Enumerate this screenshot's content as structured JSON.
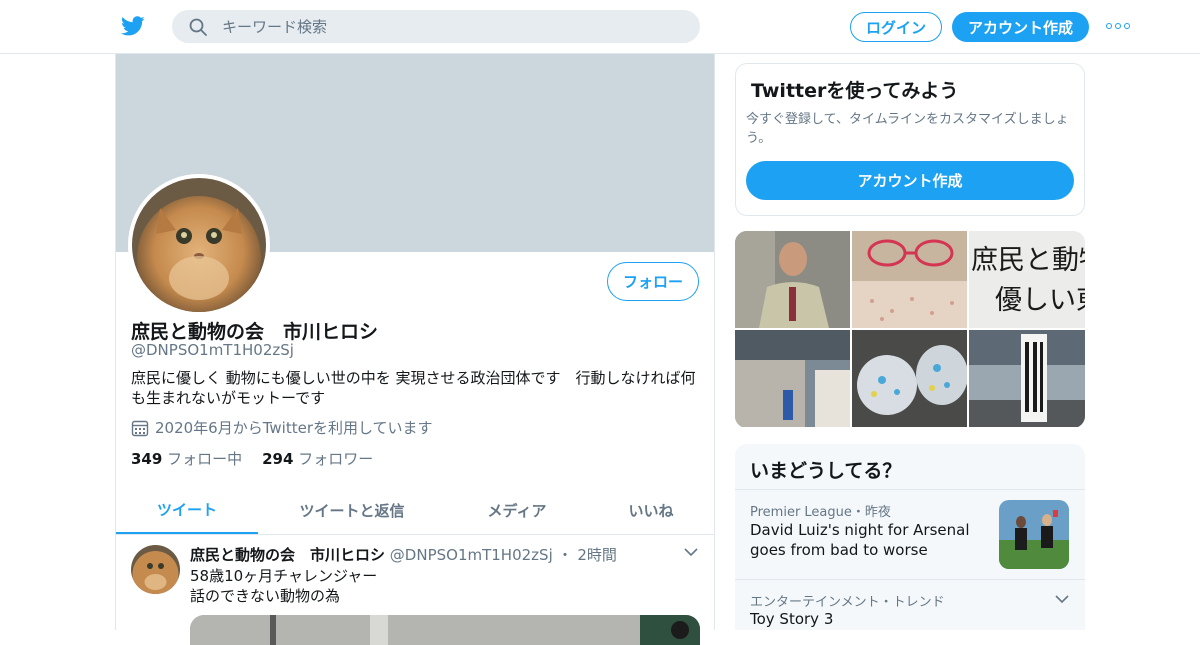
{
  "header": {
    "search_placeholder": "キーワード検索",
    "login_label": "ログイン",
    "signup_label": "アカウント作成",
    "icons": [
      "twitter-bird-icon",
      "search-icon",
      "more-dots-icon"
    ]
  },
  "profile": {
    "display_name": "庶民と動物の会　市川ヒロシ",
    "handle": "@DNPSO1mT1H02zSj",
    "follow_label": "フォロー",
    "bio": "庶民に優しく 動物にも優しい世の中を 実現させる政治団体です　行動しなければ何も生まれないがモットーです",
    "joined": "2020年6月からTwitterを利用しています",
    "following_count": "349",
    "following_label": "フォロー中",
    "followers_count": "294",
    "followers_label": "フォロワー"
  },
  "tabs": [
    {
      "label": "ツイート",
      "active": true
    },
    {
      "label": "ツイートと返信",
      "active": false
    },
    {
      "label": "メディア",
      "active": false
    },
    {
      "label": "いいね",
      "active": false
    }
  ],
  "tweet": {
    "name": "庶民と動物の会　市川ヒロシ",
    "handle": "@DNPSO1mT1H02zSj",
    "separator": "・",
    "time": "2時間",
    "line1": "58歳10ヶ月チャレンジャー",
    "line2": "話のできない動物の為"
  },
  "signup_card": {
    "title": "Twitterを使ってみよう",
    "description": "今すぐ登録して、タイムラインをカスタマイズしましょう。",
    "button_label": "アカウント作成"
  },
  "media_grid": {
    "poster_text_1": "庶民と動物",
    "poster_text_2": "優しい東"
  },
  "trends": {
    "title": "いまどうしてる？",
    "items": [
      {
        "meta": "Premier League・昨夜",
        "title": "David Luiz's night for Arsenal goes from bad to worse"
      },
      {
        "meta": "エンターテインメント・トレンド",
        "title": "Toy Story 3"
      }
    ]
  },
  "colors": {
    "accent": "#1da1f2",
    "banner": "#ccd6dd",
    "muted_text": "#657786",
    "border": "#e1e8ed",
    "panel_bg": "#f5f8fa"
  }
}
